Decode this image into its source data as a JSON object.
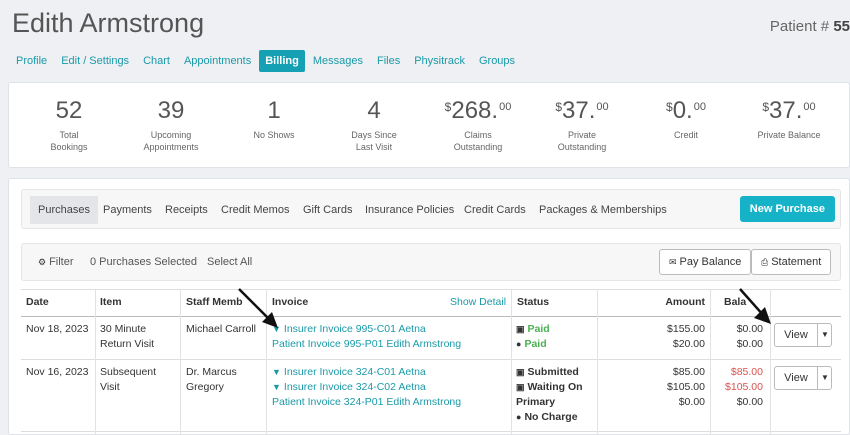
{
  "patient": {
    "name": "Edith Armstrong",
    "number_label": "Patient # ",
    "number": "55"
  },
  "tabs": [
    "Profile",
    "Edit / Settings",
    "Chart",
    "Appointments",
    "Billing",
    "Messages",
    "Files",
    "Physitrack",
    "Groups"
  ],
  "active_tab": "Billing",
  "stats": {
    "total_bookings": {
      "value": "52",
      "label1": "Total",
      "label2": "Bookings"
    },
    "upcoming": {
      "value": "39",
      "label1": "Upcoming",
      "label2": "Appointments"
    },
    "no_shows": {
      "value": "1",
      "label1": "No Shows",
      "label2": ""
    },
    "days_since": {
      "value": "4",
      "label1": "Days Since",
      "label2": "Last Visit"
    },
    "claims": {
      "currency": "$",
      "value": "268.",
      "cents": "00",
      "label1": "Claims",
      "label2": "Outstanding"
    },
    "private": {
      "currency": "$",
      "value": "37.",
      "cents": "00",
      "label1": "Private",
      "label2": "Outstanding"
    },
    "credit": {
      "currency": "$",
      "value": "0.",
      "cents": "00",
      "label1": "Credit",
      "label2": ""
    },
    "private_balance": {
      "currency": "$",
      "value": "37.",
      "cents": "00",
      "label1": "Private Balance",
      "label2": ""
    }
  },
  "subtabs": [
    "Purchases",
    "Payments",
    "Receipts",
    "Credit Memos",
    "Gift Cards",
    "Insurance Policies",
    "Credit Cards",
    "Packages & Memberships"
  ],
  "new_purchase": "New Purchase",
  "filterbar": {
    "filter": "Filter",
    "selected": "0 Purchases Selected",
    "select_all": "Select All",
    "pay_balance": "Pay Balance",
    "statement": "Statement"
  },
  "table": {
    "headers": {
      "date": "Date",
      "item": "Item",
      "staff": "Staff Memb",
      "invoice": "Invoice",
      "show_detail": "Show Detail",
      "status": "Status",
      "amount": "Amount",
      "balance": "Bala"
    },
    "rows": [
      {
        "date": "Nov 18, 2023",
        "item1": "30 Minute",
        "item2": "Return Visit",
        "staff1": "Michael Carroll",
        "staff2": "",
        "inv1": "Insurer Invoice 995-C01 Aetna",
        "inv2": "Patient Invoice 995-P01 Edith Armstrong",
        "st1": "Paid",
        "st2": "Paid",
        "amt1": "$155.00",
        "amt2": "$20.00",
        "bal1": "$0.00",
        "bal2": "$0.00",
        "view": "View"
      },
      {
        "date": "Nov 16, 2023",
        "item1": "Subsequent",
        "item2": "Visit",
        "staff1": "Dr. Marcus",
        "staff2": "Gregory",
        "inv1": "Insurer Invoice 324-C01 Aetna",
        "inv2": "Insurer Invoice 324-C02 Aetna",
        "inv3": "Patient Invoice 324-P01 Edith Armstrong",
        "st1": "Submitted",
        "st2": "Waiting On",
        "st2b": "Primary",
        "st3": "No Charge",
        "amt1": "$85.00",
        "amt2": "$105.00",
        "amt3": "$0.00",
        "bal1": "$85.00",
        "bal2": "$105.00",
        "bal3": "$0.00",
        "view": "View"
      }
    ]
  },
  "colors": {
    "accent": "#16a0b4",
    "link": "#1a9aa8",
    "paid": "#4caf50",
    "due": "#d9534f"
  }
}
